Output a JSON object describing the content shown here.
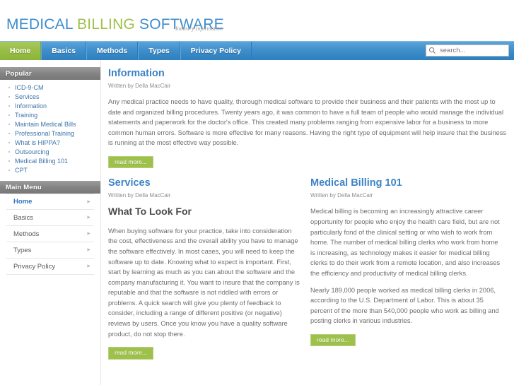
{
  "header": {
    "logo": {
      "word1": "MEDICAL",
      "word2": "BILLING",
      "word3": "SOFTWARE"
    },
    "tagline": "Industry Information",
    "accent_blue": "#3e8ccc",
    "accent_green": "#9fc04a"
  },
  "nav": {
    "items": [
      {
        "label": "Home",
        "active": true
      },
      {
        "label": "Basics",
        "active": false
      },
      {
        "label": "Methods",
        "active": false
      },
      {
        "label": "Types",
        "active": false
      },
      {
        "label": "Privacy Policy",
        "active": false
      }
    ]
  },
  "search": {
    "placeholder": "search...",
    "value": "",
    "icon": "search-icon"
  },
  "sidebar": {
    "popular": {
      "title": "Popular",
      "items": [
        "ICD-9-CM",
        "Services",
        "Information",
        "Training",
        "Maintain Medical Bills",
        "Professional Training",
        "What is HIPPA?",
        "Outsourcing",
        "Medical Billing 101",
        "CPT"
      ]
    },
    "main_menu": {
      "title": "Main Menu",
      "items": [
        {
          "label": "Home",
          "current": true
        },
        {
          "label": "Basics",
          "current": false
        },
        {
          "label": "Methods",
          "current": false
        },
        {
          "label": "Types",
          "current": false
        },
        {
          "label": "Privacy Policy",
          "current": false
        }
      ]
    }
  },
  "articles": {
    "information": {
      "title": "Information",
      "meta": "Written by Della MacCair",
      "paragraph": "Any medical practice needs to have quality, thorough medical software to provide their business and their patients with the most up to date and organized billing procedures. Twenty years ago, it was common to have a full team of people who would manage the individual statements and paperwork for the doctor's office. This created many problems ranging from expensive labor for a business to more common human errors. Software is more effective for many reasons. Having the right type of equipment will help insure that the business is running at the most effective way possible.",
      "readmore": "read more..."
    },
    "services": {
      "title": "Services",
      "meta": "Written by Della MacCair",
      "subheading": "What To Look For",
      "paragraph1": "When buying software for your practice, take into consideration the cost, effectiveness and the overall ability you have to manage the software effectively. In most cases, you will need to keep the software up to date. Knowing what to expect is important. First, start by learning as much as you can about the software and the company manufacturing it. You want to insure that the company is reputable and that the software is not riddled with errors or problems. A quick search will give you plenty of feedback to consider, including a range of different positive (or negative) reviews by users. Once you know you have a quality software product, do not stop there.",
      "readmore": "read more..."
    },
    "billing101": {
      "title": "Medical Billing 101",
      "meta": "Written by Della MacCair",
      "paragraph1": "Medical billing is becoming an increasingly attractive career opportunity for people who enjoy the health care field, but are not particularly fond of the clinical setting or who wish to work from home. The number of medical billing clerks who work from home is increasing, as technology makes it easier for medical billing clerks to do their work from a remote location, and also increases the efficiency and productivity of medical billing clerks.",
      "paragraph2": "Nearly 189,000 people worked as medical billing clerks in 2006, according to the U.S. Department of Labor. This is about 35 percent of the more than 540,000 people who work as billing and posting clerks in various industries.",
      "readmore": "read more..."
    }
  }
}
